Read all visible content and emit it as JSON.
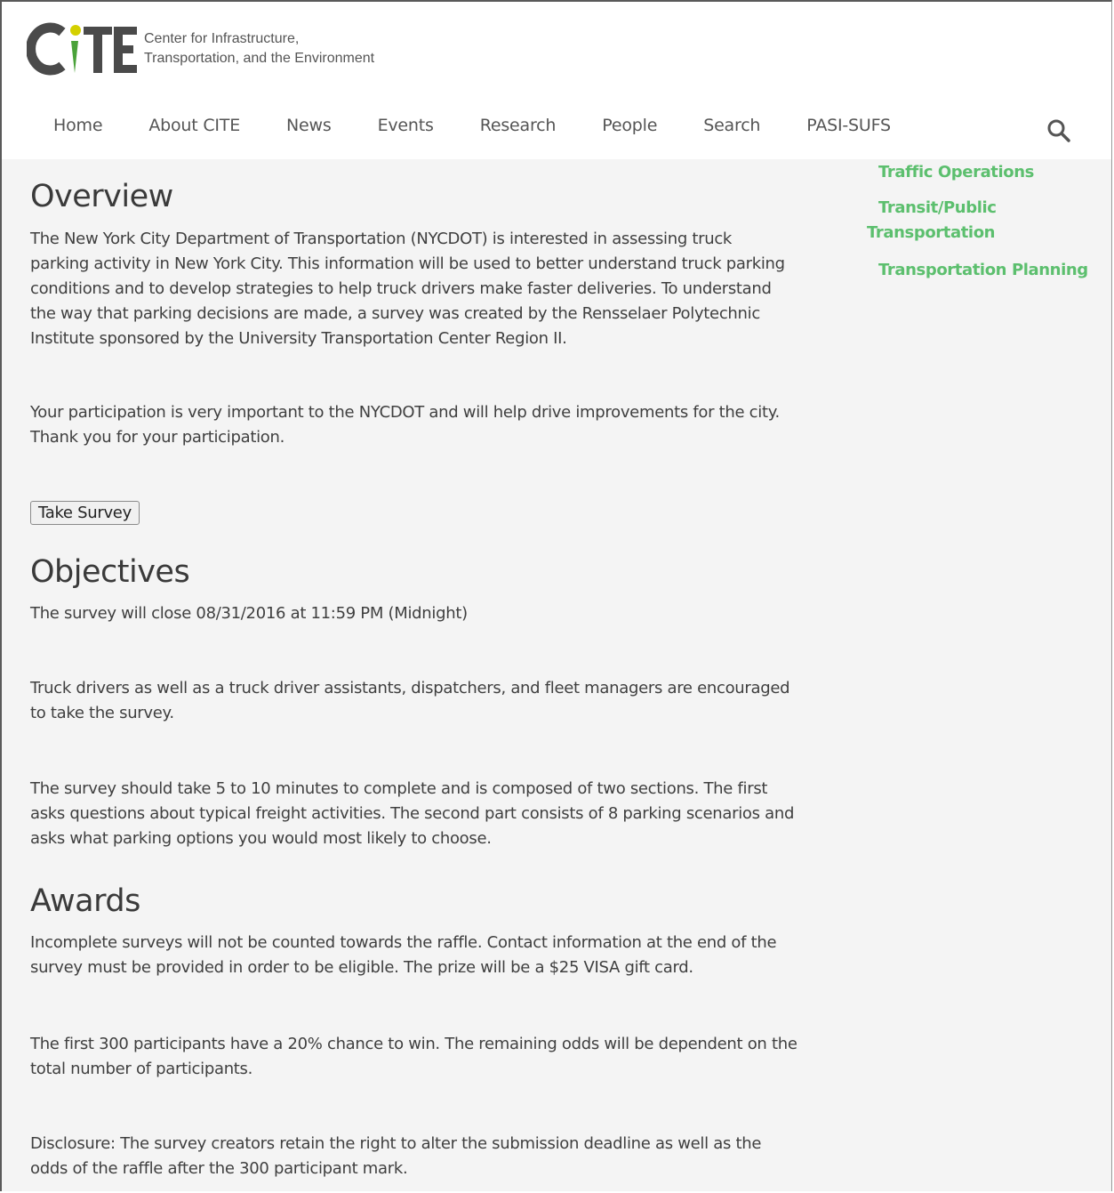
{
  "header": {
    "logo_text": "CITE",
    "tagline_line1": "Center for Infrastructure,",
    "tagline_line2": "Transportation, and the Environment"
  },
  "nav": {
    "items": [
      "Home",
      "About CITE",
      "News",
      "Events",
      "Research",
      "People",
      "Search",
      "PASI-SUFS"
    ],
    "search_icon": "search-icon"
  },
  "sidebar": {
    "links": [
      "Traffic Operations",
      "Transit/Public",
      "Transportation",
      "Transportation Planning"
    ]
  },
  "overview": {
    "heading": "Overview",
    "para1": [
      "The New York City Department of Transportation (NYCDOT) is interested in assessing truck",
      "parking activity in New York City. This information will be used to better understand truck parking",
      "conditions and to develop strategies to help truck drivers make faster deliveries. To understand",
      "the way that parking decisions are made, a survey was created by the Rensselaer Polytechnic",
      "Institute sponsored by the University Transportation Center Region II."
    ],
    "para2": [
      "Your participation is very important to the NYCDOT and will help drive improvements for the city.",
      "Thank you for your participation."
    ],
    "button": "Take Survey"
  },
  "objectives": {
    "heading": "Objectives",
    "para1": [
      "The survey will close 08/31/2016 at 11:59 PM (Midnight)"
    ],
    "para2": [
      "Truck drivers as well as a truck driver assistants, dispatchers, and fleet managers are encouraged",
      "to take the survey."
    ],
    "para3": [
      "The survey should take 5 to 10 minutes to complete and is composed of two sections. The first",
      "asks questions about typical freight activities. The second part consists of 8 parking scenarios and",
      "asks what parking options you would most likely to choose."
    ]
  },
  "awards": {
    "heading": "Awards",
    "para1": [
      "Incomplete surveys will not be counted towards the raffle. Contact information at the end of the",
      "survey must be provided in order to be eligible. The prize will be a $25 VISA gift card."
    ],
    "para2": [
      "The first 300 participants have a 20% chance to win. The remaining odds will be dependent on the",
      "total number of participants."
    ],
    "para3": [
      "Disclosure: The survey creators retain the right to alter the submission deadline as well as the",
      "odds of the raffle after the 300 participant mark."
    ]
  },
  "colors": {
    "accent_green": "#5cbf6e",
    "logo_yellow": "#d4d000",
    "logo_green": "#4aa23a",
    "logo_gray": "#4a4a4a"
  }
}
